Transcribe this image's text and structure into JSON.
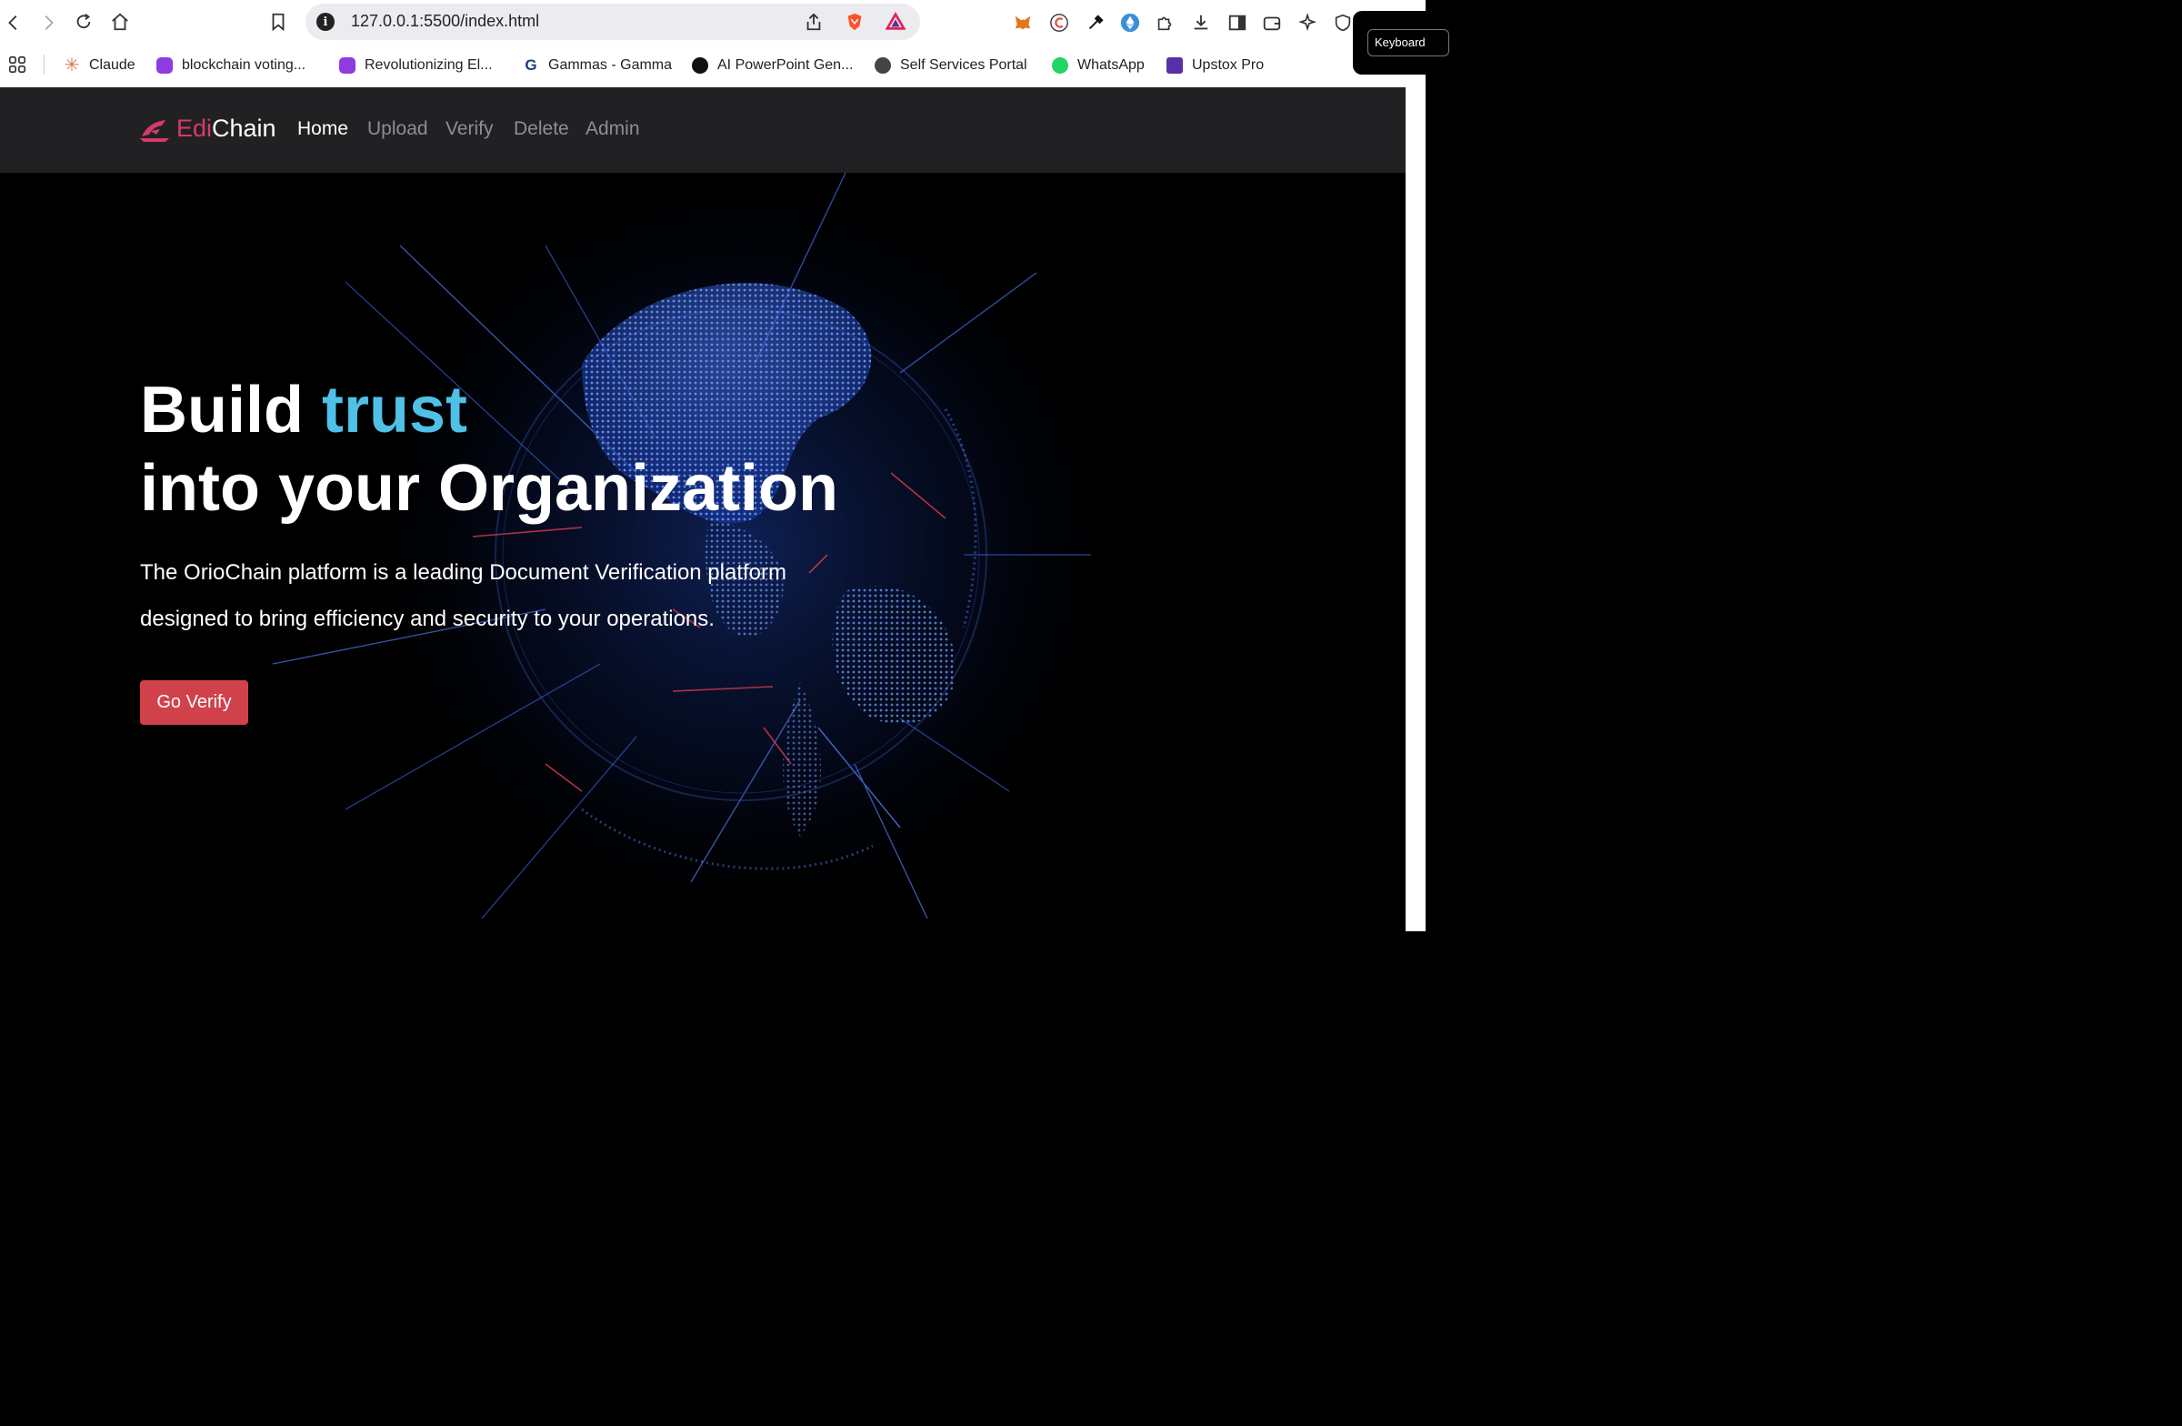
{
  "browser": {
    "url": "127.0.0.1:5500/index.html",
    "bookmarks": [
      {
        "label": "Claude",
        "color": "#d97757"
      },
      {
        "label": "blockchain voting...",
        "color": "#8e3be0"
      },
      {
        "label": "Revolutionizing El...",
        "color": "#8e3be0"
      },
      {
        "label": "Gammas - Gamma",
        "color": "#1f3c88"
      },
      {
        "label": "AI PowerPoint Gen...",
        "color": "#111111"
      },
      {
        "label": "Self Services Portal",
        "color": "#444444"
      },
      {
        "label": "WhatsApp",
        "color": "#25d366"
      },
      {
        "label": "Upstox Pro",
        "color": "#5a2ea6"
      }
    ],
    "tooltip": "Keyboard"
  },
  "site": {
    "brand": {
      "part1": "Edi",
      "part2": "Chain"
    },
    "nav": [
      {
        "label": "Home",
        "active": true
      },
      {
        "label": "Upload",
        "active": false
      },
      {
        "label": "Verify",
        "active": false
      },
      {
        "label": "Delete",
        "active": false
      },
      {
        "label": "Admin",
        "active": false
      }
    ],
    "hero": {
      "title_line1_a": "Build",
      "title_line1_b": "trust",
      "title_line2": "into your Organization",
      "lead": "The OrioChain platform is a leading Document Verification platform designed to bring efficiency and security to your operations.",
      "cta": "Go Verify"
    },
    "colors": {
      "brand_accent": "#d63a6a",
      "title_accent": "#4fc1e6",
      "cta": "#d1414a",
      "navbar": "#212124"
    }
  }
}
